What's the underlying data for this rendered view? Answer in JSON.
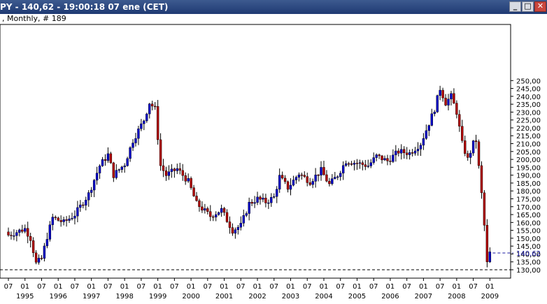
{
  "window": {
    "title": "PY - 140,62 - 19:00:18  07 ene (CET)",
    "subtitle": ", Monthly, # 189",
    "buttons": {
      "minimize": "_",
      "maximize": "□",
      "close": "✕"
    }
  },
  "colors": {
    "up": "#0000c8",
    "down": "#b00000",
    "wick": "#000000",
    "frame": "#000000",
    "lastPrice": "#1a1aa0"
  },
  "chart_data": {
    "type": "candlestick",
    "y_ticks": [
      "130,00",
      "135,00",
      "140,00",
      "145,00",
      "150,00",
      "155,00",
      "160,00",
      "165,00",
      "170,00",
      "175,00",
      "180,00",
      "185,00",
      "190,00",
      "195,00",
      "200,00",
      "205,00",
      "210,00",
      "215,00",
      "220,00",
      "225,00",
      "230,00",
      "235,00",
      "240,00",
      "245,00",
      "250,00"
    ],
    "ylim": [
      127,
      252
    ],
    "x_month_labels": [
      "07",
      "01",
      "07",
      "01",
      "07",
      "01",
      "07",
      "01",
      "07",
      "01",
      "07",
      "01",
      "07",
      "01",
      "07",
      "01",
      "07",
      "01",
      "07",
      "01",
      "07",
      "01",
      "07",
      "01",
      "07",
      "01",
      "07",
      "01",
      "07",
      "01"
    ],
    "x_year_labels": [
      "1995",
      "1996",
      "1997",
      "1998",
      "1999",
      "2000",
      "2001",
      "2002",
      "2003",
      "2004",
      "2005",
      "2006",
      "2007",
      "2008",
      "2009"
    ],
    "last_price_label": "140,62",
    "last_price": 140.62,
    "support_line": 130.0,
    "anchors": [
      {
        "t": "1994-07",
        "v": 152
      },
      {
        "t": "1995-01",
        "v": 156
      },
      {
        "t": "1995-03",
        "v": 150
      },
      {
        "t": "1995-05",
        "v": 134
      },
      {
        "t": "1995-07",
        "v": 137
      },
      {
        "t": "1995-09",
        "v": 151
      },
      {
        "t": "1995-11",
        "v": 163
      },
      {
        "t": "1996-03",
        "v": 160
      },
      {
        "t": "1996-07",
        "v": 165
      },
      {
        "t": "1996-12",
        "v": 178
      },
      {
        "t": "1997-04",
        "v": 196
      },
      {
        "t": "1997-07",
        "v": 203
      },
      {
        "t": "1997-09",
        "v": 190
      },
      {
        "t": "1998-01",
        "v": 197
      },
      {
        "t": "1998-04",
        "v": 212
      },
      {
        "t": "1998-08",
        "v": 225
      },
      {
        "t": "1998-10",
        "v": 236
      },
      {
        "t": "1998-12",
        "v": 232
      },
      {
        "t": "1999-02",
        "v": 196
      },
      {
        "t": "1999-04",
        "v": 190
      },
      {
        "t": "1999-08",
        "v": 194
      },
      {
        "t": "1999-12",
        "v": 186
      },
      {
        "t": "2000-03",
        "v": 172
      },
      {
        "t": "2000-08",
        "v": 164
      },
      {
        "t": "2000-12",
        "v": 168
      },
      {
        "t": "2001-04",
        "v": 155
      },
      {
        "t": "2001-07",
        "v": 158
      },
      {
        "t": "2001-10",
        "v": 172
      },
      {
        "t": "2002-01",
        "v": 175
      },
      {
        "t": "2002-04",
        "v": 173
      },
      {
        "t": "2002-07",
        "v": 176
      },
      {
        "t": "2002-09",
        "v": 189
      },
      {
        "t": "2002-12",
        "v": 182
      },
      {
        "t": "2003-04",
        "v": 191
      },
      {
        "t": "2003-08",
        "v": 186
      },
      {
        "t": "2003-12",
        "v": 193
      },
      {
        "t": "2004-03",
        "v": 184
      },
      {
        "t": "2004-06",
        "v": 190
      },
      {
        "t": "2004-09",
        "v": 199
      },
      {
        "t": "2004-12",
        "v": 198
      },
      {
        "t": "2005-05",
        "v": 196
      },
      {
        "t": "2005-08",
        "v": 202
      },
      {
        "t": "2005-12",
        "v": 199
      },
      {
        "t": "2006-04",
        "v": 205
      },
      {
        "t": "2006-08",
        "v": 204
      },
      {
        "t": "2006-12",
        "v": 210
      },
      {
        "t": "2007-03",
        "v": 223
      },
      {
        "t": "2007-05",
        "v": 232
      },
      {
        "t": "2007-07",
        "v": 245
      },
      {
        "t": "2007-09",
        "v": 236
      },
      {
        "t": "2007-11",
        "v": 240
      },
      {
        "t": "2008-01",
        "v": 230
      },
      {
        "t": "2008-03",
        "v": 210
      },
      {
        "t": "2008-05",
        "v": 200
      },
      {
        "t": "2008-07",
        "v": 210
      },
      {
        "t": "2008-08",
        "v": 212
      },
      {
        "t": "2008-10",
        "v": 178
      },
      {
        "t": "2008-11",
        "v": 158
      },
      {
        "t": "2008-12",
        "v": 134
      },
      {
        "t": "2009-01",
        "v": 140.62
      }
    ]
  }
}
